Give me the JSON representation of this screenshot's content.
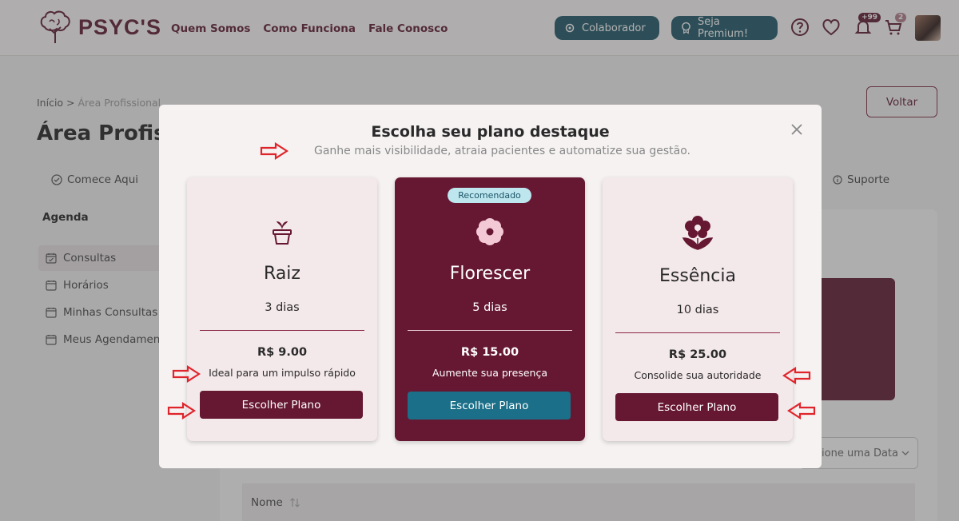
{
  "header": {
    "brand": "PSYC'S",
    "nav": [
      "Quem Somos",
      "Como Funciona",
      "Fale Conosco"
    ],
    "colaborador_label": "Colaborador",
    "premium_label": "Seja Premium!",
    "notifications_badge": "+99",
    "cart_badge": "2"
  },
  "page": {
    "breadcrumb_home": "Início",
    "breadcrumb_sep": " > ",
    "breadcrumb_current": "Área Profissional",
    "title": "Área Profiss",
    "back_label": "Voltar",
    "tab_start": "Comece Aqui",
    "tab_support": "Suporte",
    "sidebar_heading": "Agenda",
    "sidebar_items": [
      "Consultas",
      "Horários",
      "Minhas Consultas",
      "Meus Agendament"
    ],
    "date_placeholder": "ione uma Data",
    "table_column_name": "Nome"
  },
  "modal": {
    "title": "Escolha seu plano destaque",
    "subtitle": "Ganhe mais visibilidade, atraia pacientes e automatize sua gestão.",
    "plans": [
      {
        "name": "Raiz",
        "duration": "3 dias",
        "price": "R$ 9.00",
        "description": "Ideal para um impulso rápido",
        "button": "Escolher Plano",
        "icon": "plant-pot-icon"
      },
      {
        "name": "Florescer",
        "duration": "5 dias",
        "price": "R$ 15.00",
        "description": "Aumente sua presença",
        "button": "Escolher Plano",
        "badge": "Recomendado",
        "icon": "flower-icon"
      },
      {
        "name": "Essência",
        "duration": "10 dias",
        "price": "R$ 25.00",
        "description": "Consolide sua autoridade",
        "button": "Escolher Plano",
        "icon": "blooming-flower-icon"
      }
    ]
  },
  "colors": {
    "brand": "#5c1830",
    "card_dark": "#661833",
    "button_dark": "#661833",
    "button_teal": "#1b6f88",
    "annotation_arrow": "#e0242b"
  }
}
